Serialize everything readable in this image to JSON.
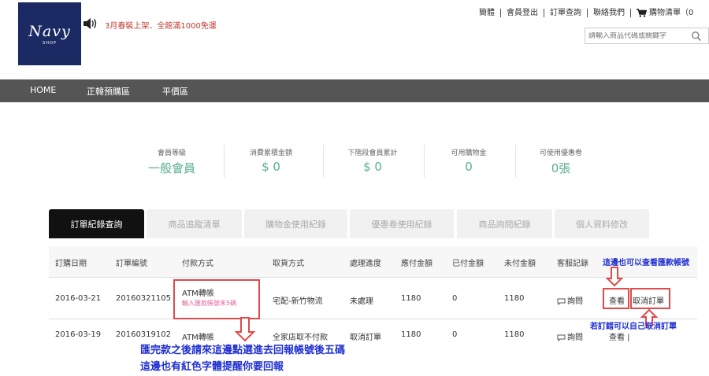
{
  "header": {
    "logo": {
      "brand": "Navy",
      "sub": "SHOP"
    },
    "promo_text": "3月春裝上架．全館滿1000免運",
    "top_links": [
      "簡體",
      "會員登出",
      "訂單查詢",
      "聯絡我們"
    ],
    "cart_label": "購物清單（0",
    "search_placeholder": "請輸入商品代碼或關鍵字"
  },
  "nav": {
    "items": [
      "HOME",
      "正韓預購區",
      "平價區"
    ]
  },
  "stats": [
    {
      "label": "會員等級",
      "value": "一般會員"
    },
    {
      "label": "消費累積金額",
      "value": "$ 0"
    },
    {
      "label": "下階段會員累計",
      "value": "$ 0"
    },
    {
      "label": "可用購物金",
      "value": "0"
    },
    {
      "label": "可使用優惠卷",
      "value": "0張"
    }
  ],
  "tabs": [
    "訂單紀錄查詢",
    "商品追蹤清單",
    "購物金使用紀錄",
    "優惠卷使用紀錄",
    "商品詢問紀錄",
    "個人資料修改"
  ],
  "table": {
    "headers": [
      "訂購日期",
      "訂單編號",
      "付款方式",
      "取貨方式",
      "處理進度",
      "應付金額",
      "已付金額",
      "未付金額",
      "客服記錄"
    ],
    "rows": [
      {
        "date": "2016-03-21",
        "order_no": "20160321105",
        "payment": "ATM轉帳",
        "payment_hint": "輸入匯款帳號末5碼",
        "delivery": "宅配-新竹物流",
        "status": "未處理",
        "due": "1180",
        "paid": "0",
        "unpaid": "1180",
        "service": "詢問",
        "view": "查看",
        "cancel": "取消訂單"
      },
      {
        "date": "2016-03-19",
        "order_no": "20160319102",
        "payment": "ATM轉帳",
        "delivery": "全家店取不付款",
        "status": "取消訂單",
        "due": "1180",
        "paid": "0",
        "unpaid": "1180",
        "service": "詢問",
        "view": "查看 |"
      }
    ]
  },
  "annotations": {
    "view_note": "這邊也可以查看匯款帳號",
    "cancel_note": "若訂錯可以自己取消訂單",
    "payment_note_1": "匯完款之後請來這邊點選進去回報帳號後五碼",
    "payment_note_2": "這邊也有紅色字體提醒你要回報"
  },
  "colors": {
    "nav_bg": "#555555",
    "stat_value": "#5aae8e",
    "annotation_blue": "#1f2fd0",
    "annotation_red": "#e04a4a",
    "promo_red": "#c0392b",
    "hint_pink": "#e8609a"
  }
}
